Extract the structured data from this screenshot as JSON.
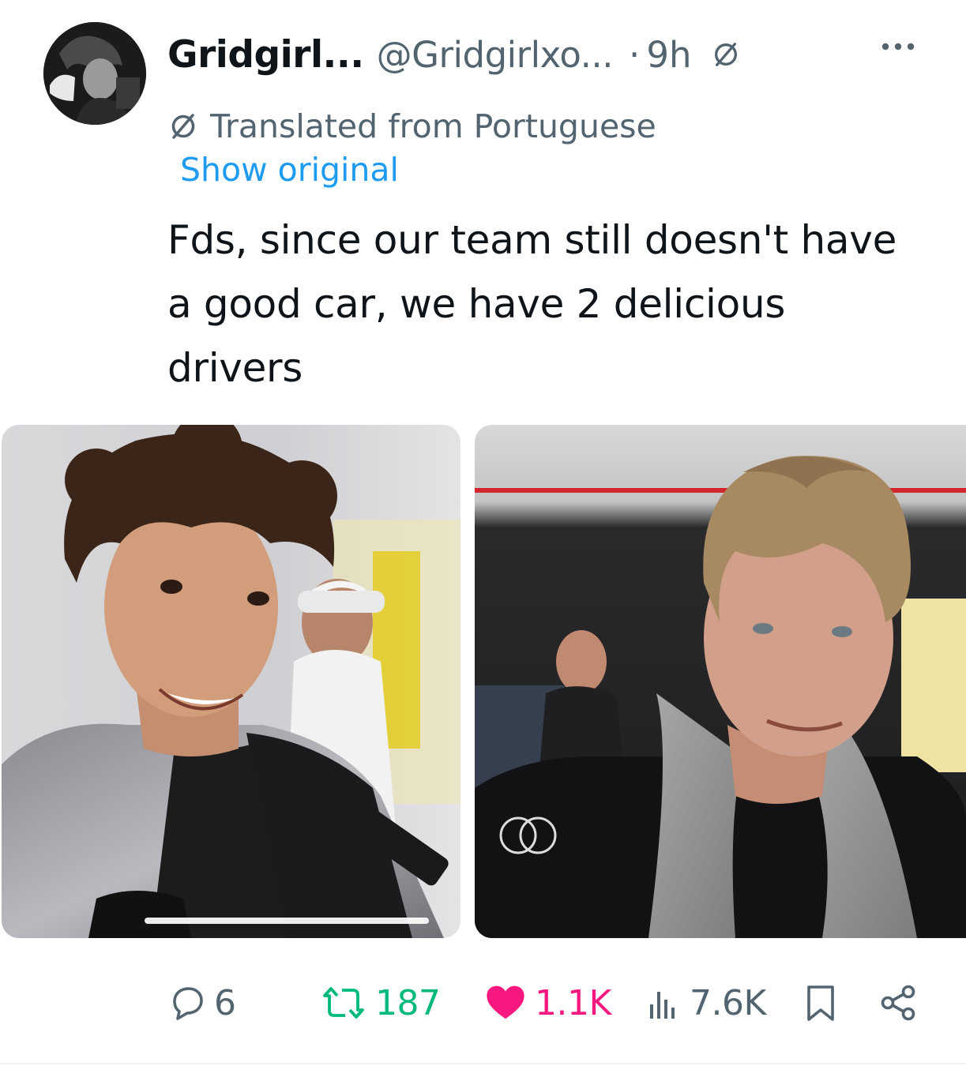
{
  "tweet": {
    "display_name": "Gridgirl...",
    "handle": "@Gridgirlxo...",
    "separator": "·",
    "time": "9h",
    "translated_label": "Translated from Portuguese",
    "show_original_label": "Show original",
    "text": "Fds, since our team still doesn't have a good car, we have 2 delicious drivers"
  },
  "media": [
    {
      "name": "photo-driver-1"
    },
    {
      "name": "photo-driver-2"
    }
  ],
  "actions": {
    "replies": "6",
    "retweets": "187",
    "likes": "1.1K",
    "views": "7.6K"
  },
  "colors": {
    "text_primary": "#0f1419",
    "text_secondary": "#536471",
    "link": "#1d9bf0",
    "retweet": "#00ba7c",
    "like": "#f91880"
  },
  "icons": {
    "translate": "translate-icon",
    "more": "more-icon",
    "reply": "reply-icon",
    "retweet": "retweet-icon",
    "like": "heart-icon",
    "views": "views-icon",
    "bookmark": "bookmark-icon",
    "share": "share-icon"
  }
}
